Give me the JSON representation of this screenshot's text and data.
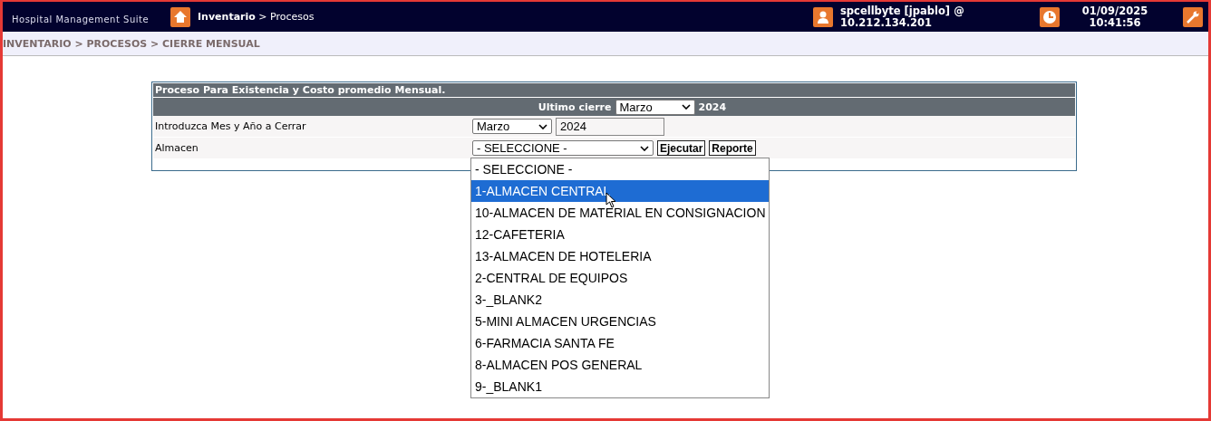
{
  "header": {
    "brand": "Hospital Management Suite",
    "breadcrumb": "**Inventario** > Procesos",
    "user": "spcellbyte [jpablo] @",
    "ip": "10.212.134.201",
    "date": "01/09/2025",
    "time": "10:41:56"
  },
  "path": "INVENTARIO > PROCESOS > CIERRE MENSUAL",
  "panel": {
    "title": "Proceso Para Existencia y Costo promedio Mensual.",
    "last_close_label": "Ultimo cierre",
    "last_close_month": "Marzo",
    "last_close_year": "2024",
    "period_label": "Introduzca Mes y Año a Cerrar",
    "period_month": "Marzo",
    "period_year": "2024",
    "store_label": "Almacen",
    "store_value": "- SELECCIONE -",
    "buttons": [
      "Ejecutar",
      "Reporte"
    ]
  },
  "store_options": [
    {
      "label": "- SELECCIONE -",
      "selected": false
    },
    {
      "label": "1-ALMACEN CENTRAL",
      "selected": true
    },
    {
      "label": "10-ALMACEN DE MATERIAL EN CONSIGNACION",
      "selected": false
    },
    {
      "label": "12-CAFETERIA",
      "selected": false
    },
    {
      "label": "13-ALMACEN DE HOTELERIA",
      "selected": false
    },
    {
      "label": "2-CENTRAL DE EQUIPOS",
      "selected": false
    },
    {
      "label": "3-_BLANK2",
      "selected": false
    },
    {
      "label": "5-MINI ALMACEN URGENCIAS",
      "selected": false
    },
    {
      "label": "6-FARMACIA SANTA FE",
      "selected": false
    },
    {
      "label": "8-ALMACEN POS GENERAL",
      "selected": false
    },
    {
      "label": "9-_BLANK1",
      "selected": false
    }
  ]
}
